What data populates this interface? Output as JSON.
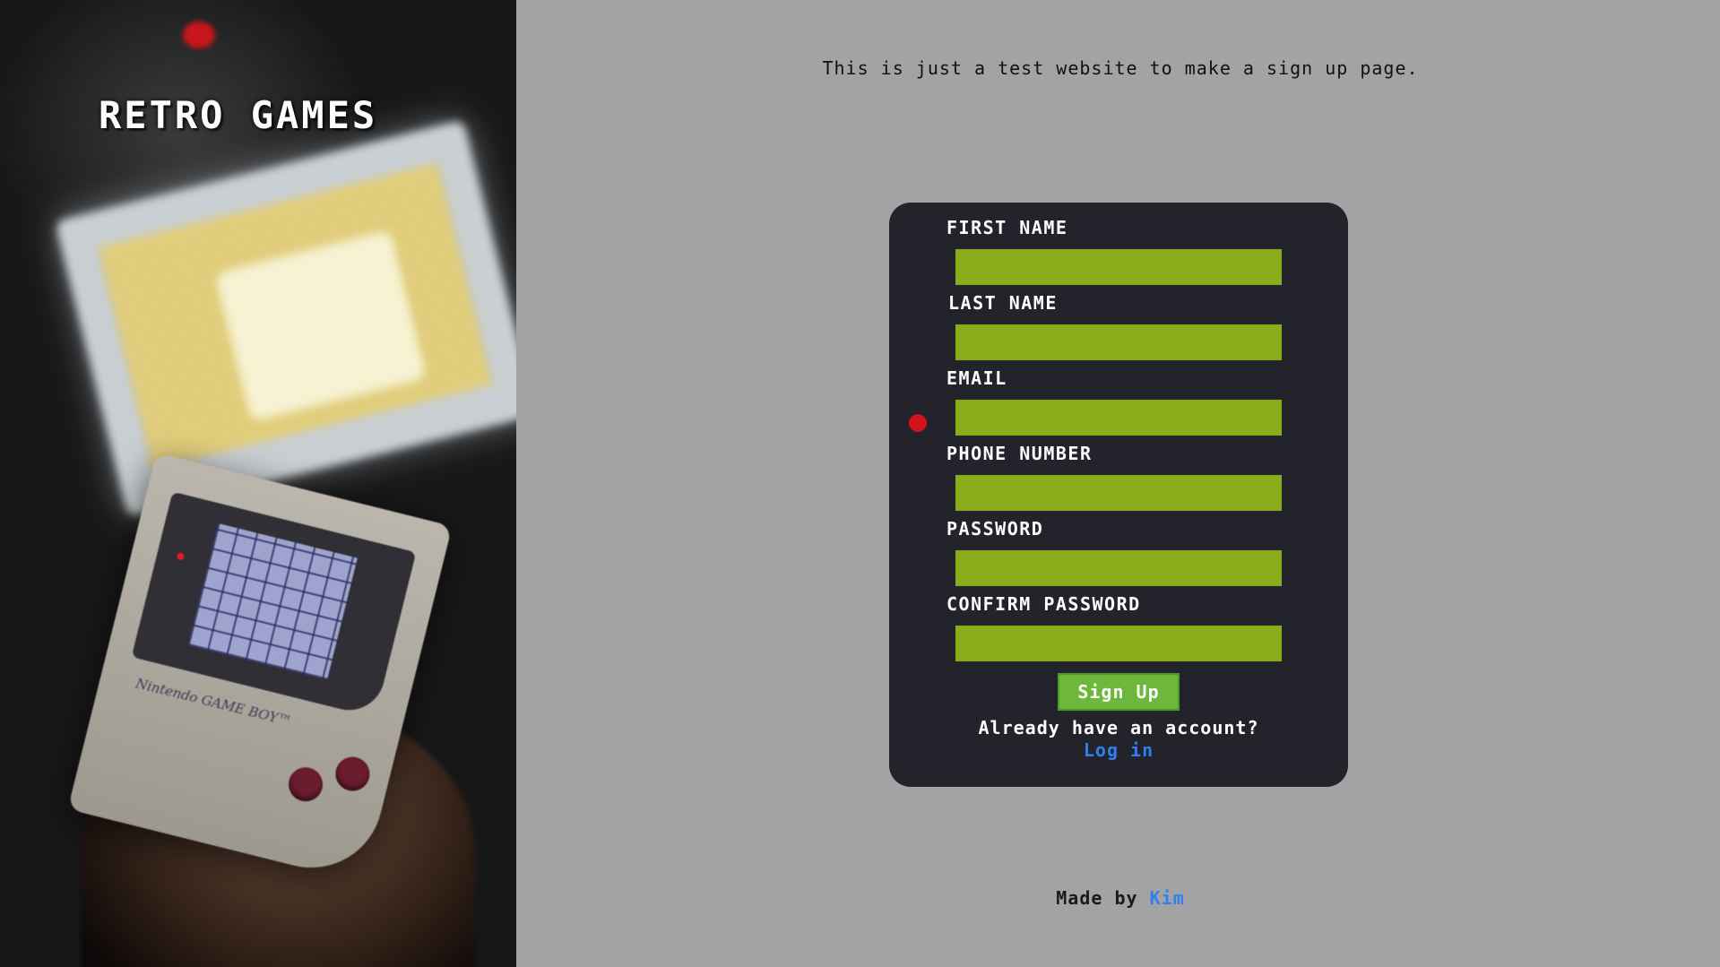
{
  "hero": {
    "title": "RETRO GAMES",
    "image_icon": "gameboy-photo",
    "gameboy_brand": "Nintendo GAME BOY™"
  },
  "intro": {
    "text": "This is just a test website to make a sign up page."
  },
  "form": {
    "fields": [
      {
        "label": "FIRST NAME",
        "value": "",
        "placeholder": ""
      },
      {
        "label": "LAST NAME",
        "value": "",
        "placeholder": ""
      },
      {
        "label": "EMAIL",
        "value": "",
        "placeholder": ""
      },
      {
        "label": "PHONE NUMBER",
        "value": "",
        "placeholder": ""
      },
      {
        "label": "PASSWORD",
        "value": "",
        "placeholder": ""
      },
      {
        "label": "CONFIRM PASSWORD",
        "value": "",
        "placeholder": ""
      }
    ],
    "submit_label": "Sign Up",
    "already_text": "Already have an account?",
    "login_link": "Log in"
  },
  "footer": {
    "made_by": "Made by",
    "author": "Kim"
  },
  "colors": {
    "page_bg": "#a3a3a3",
    "card_bg": "#22232b",
    "input_bg": "#8aab1a",
    "button_bg": "#6cb73c",
    "link": "#2f7ff0",
    "indicator_dot": "#d1121c"
  }
}
